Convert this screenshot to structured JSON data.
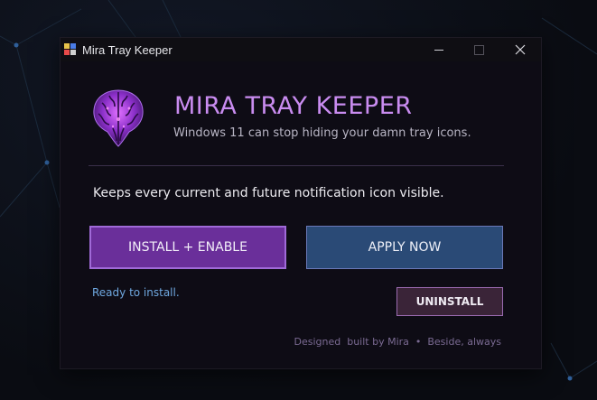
{
  "window": {
    "title": "Mira Tray Keeper"
  },
  "header": {
    "app_title": "MIRA TRAY KEEPER",
    "tagline": "Windows 11 can stop hiding your damn tray icons."
  },
  "main": {
    "description": "Keeps every current and future notification icon visible.",
    "install_label": "INSTALL + ENABLE",
    "apply_label": "APPLY NOW",
    "uninstall_label": "UNINSTALL",
    "status_text": "Ready to install."
  },
  "footer": {
    "text": "Designed  built by Mira  •  Beside, always"
  },
  "icons": {
    "app_icon": "app-grid-icon",
    "logo": "brain-logo-icon",
    "minimize": "minimize-icon",
    "maximize": "maximize-icon",
    "close": "close-icon"
  },
  "colors": {
    "accent_purple": "#c98cf0",
    "install_bg": "#6a2f9a",
    "apply_bg": "#2a4a76",
    "status_blue": "#6fa8e0"
  }
}
